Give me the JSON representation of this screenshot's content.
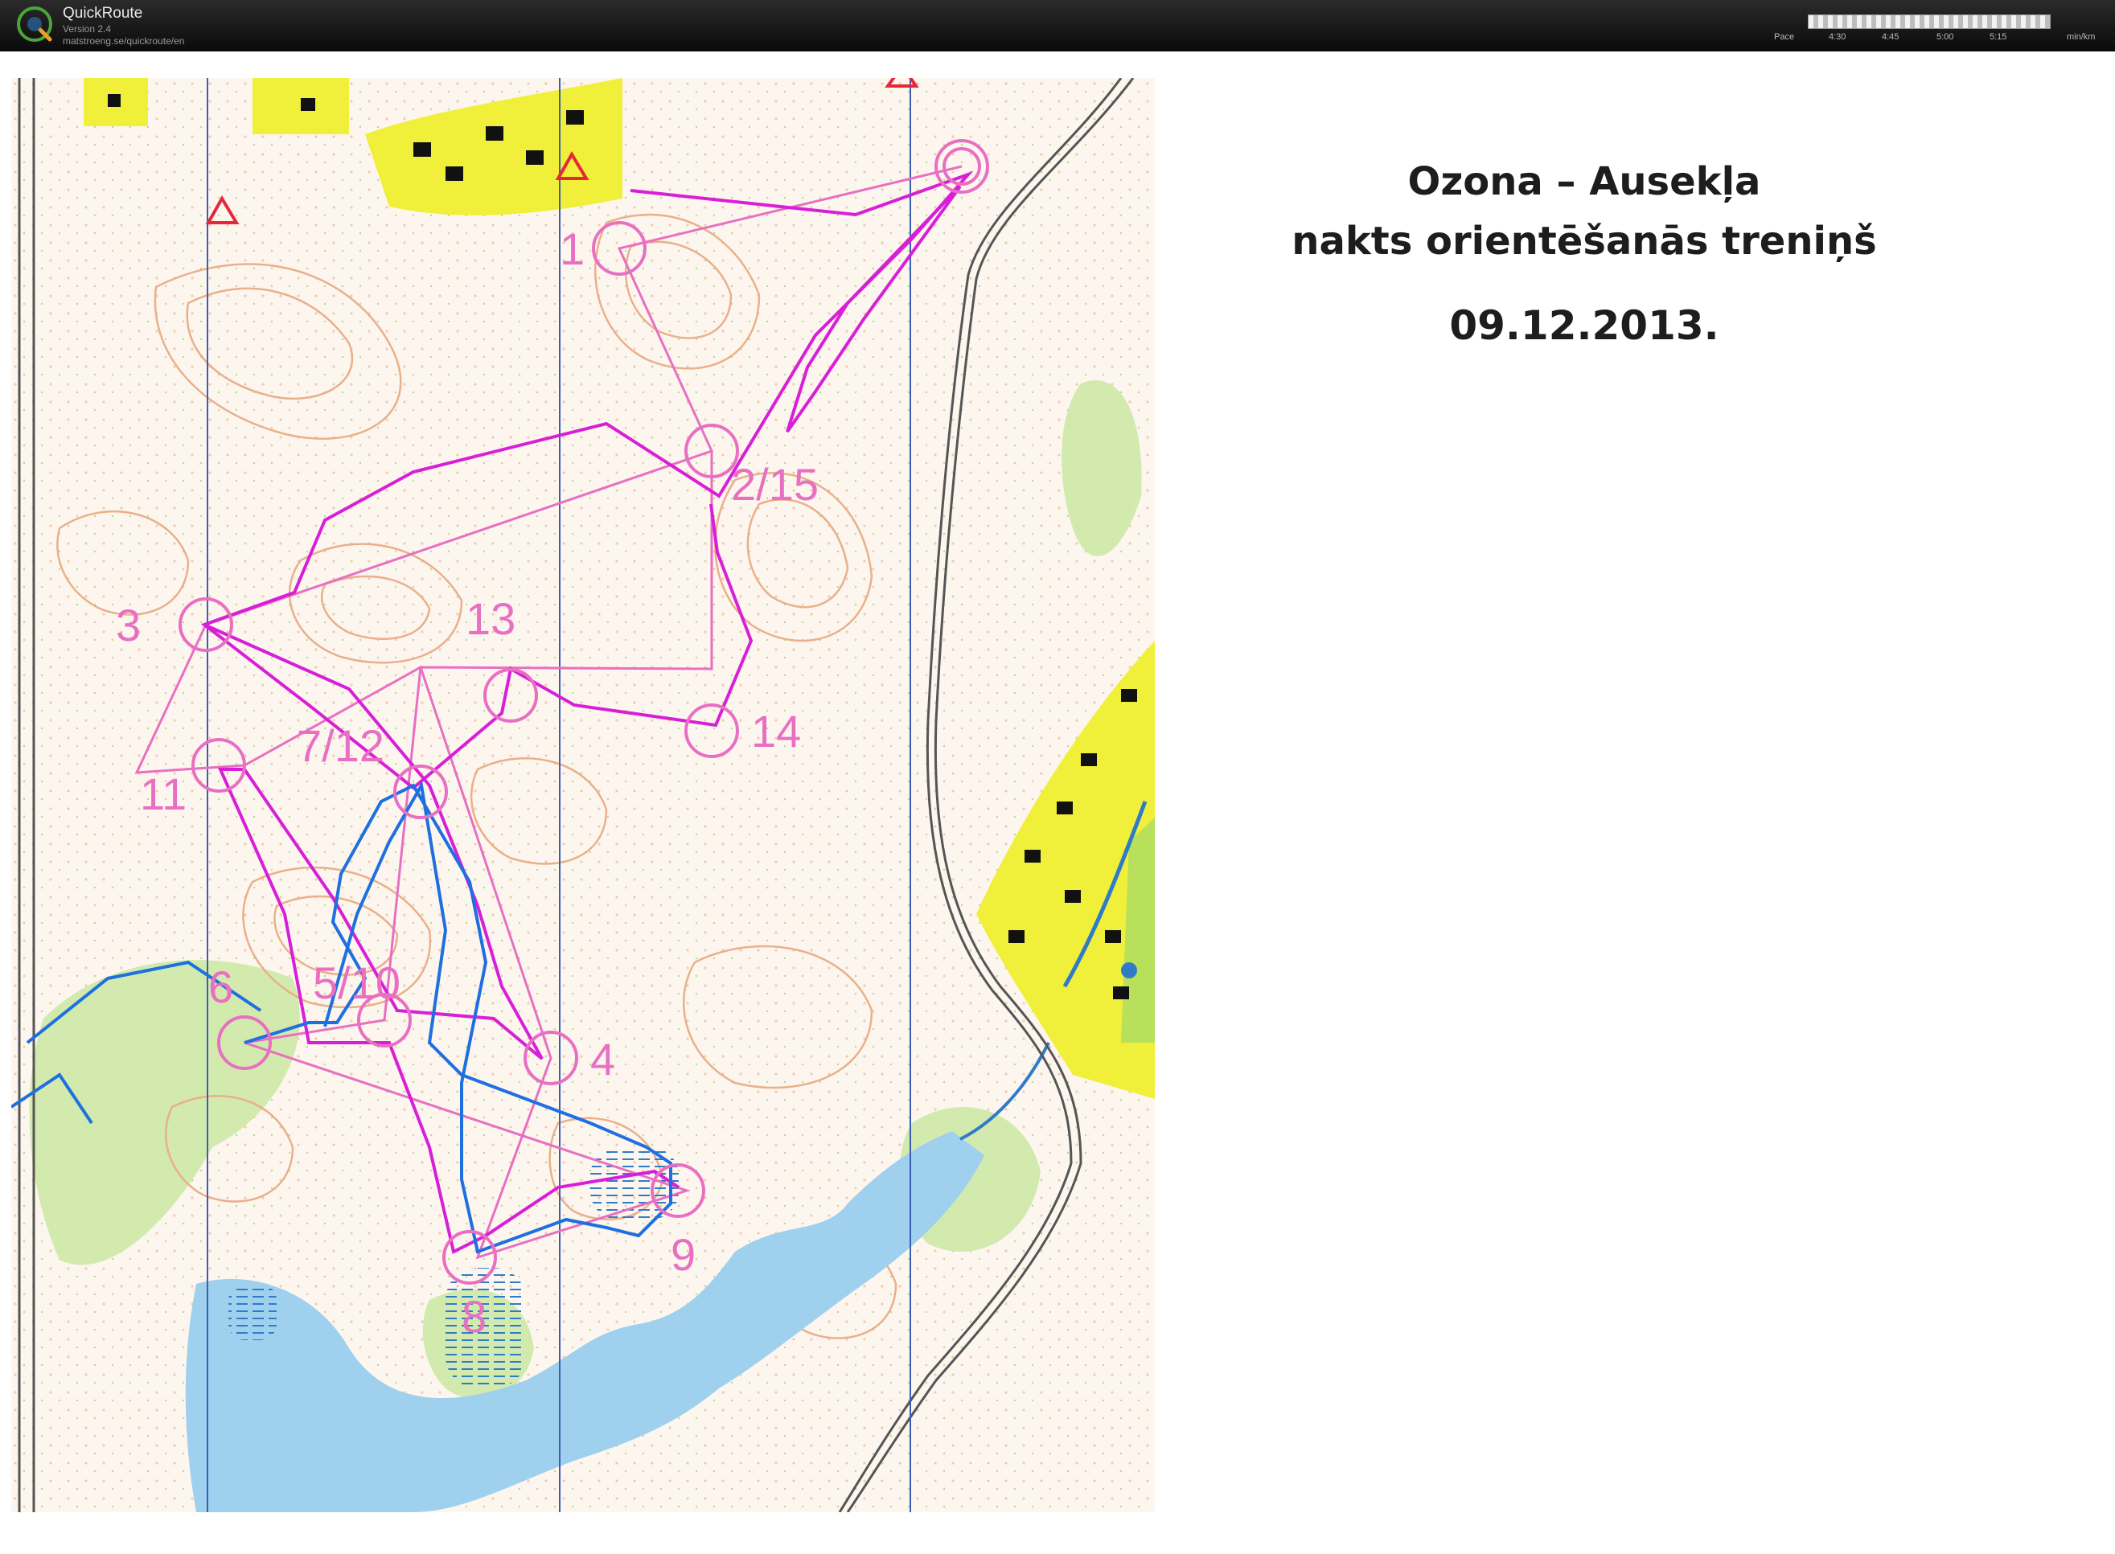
{
  "app": {
    "name": "QuickRoute",
    "version": "Version 2.4",
    "url": "matstroeng.se/quickroute/en",
    "logo_letter": "Q"
  },
  "pace_legend": {
    "label": "Pace",
    "ticks": [
      "4:30",
      "4:45",
      "5:00",
      "5:15"
    ],
    "unit": "min/km"
  },
  "title": {
    "line1": "Ozona – Ausekļa",
    "line2": "nakts orientēšanās treniņš",
    "line3": "09.12.2013."
  },
  "controls": [
    "1",
    "2/15",
    "3",
    "4",
    "5/10",
    "6",
    "7/12",
    "8",
    "9",
    "11",
    "13",
    "14"
  ],
  "colors": {
    "course": "#e86fc2",
    "route_gps": "#d81fd8",
    "route_blue": "#1e6fe0",
    "contour": "#e9b08a",
    "forest_green": "#cde9a6",
    "water": "#9fd0ee",
    "settlement_yellow": "#f0ef3a",
    "magnetic_north": "#3a5db5"
  }
}
